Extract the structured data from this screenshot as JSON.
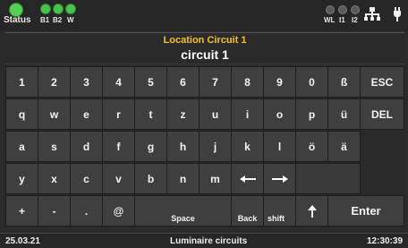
{
  "status": {
    "main_label": "Status",
    "indicators": [
      "B1",
      "B2",
      "W"
    ],
    "right_indicators": [
      "WL",
      "I1",
      "I2"
    ]
  },
  "display": {
    "title": "Location Circuit 1",
    "value": "circuit 1"
  },
  "keyboard": {
    "row1": [
      "1",
      "2",
      "3",
      "4",
      "5",
      "6",
      "7",
      "8",
      "9",
      "0",
      "ß",
      "ESC"
    ],
    "row2": [
      "q",
      "w",
      "e",
      "r",
      "t",
      "z",
      "u",
      "i",
      "o",
      "p",
      "ü",
      "DEL"
    ],
    "row3": [
      "a",
      "s",
      "d",
      "f",
      "g",
      "h",
      "j",
      "k",
      "l",
      "ö",
      "ä"
    ],
    "row4": [
      "y",
      "x",
      "c",
      "v",
      "b",
      "n",
      "m"
    ],
    "row5": [
      "+",
      "-",
      ".",
      "@"
    ],
    "space_label": "Space",
    "back_label": "Back",
    "shift_label": "shift",
    "enter_label": "Enter"
  },
  "footer": {
    "date": "25.03.21",
    "title": "Luminaire circuits",
    "time": "12:30:39"
  },
  "colors": {
    "title_accent": "#f2c12e",
    "status_ok": "#4cc24e"
  }
}
